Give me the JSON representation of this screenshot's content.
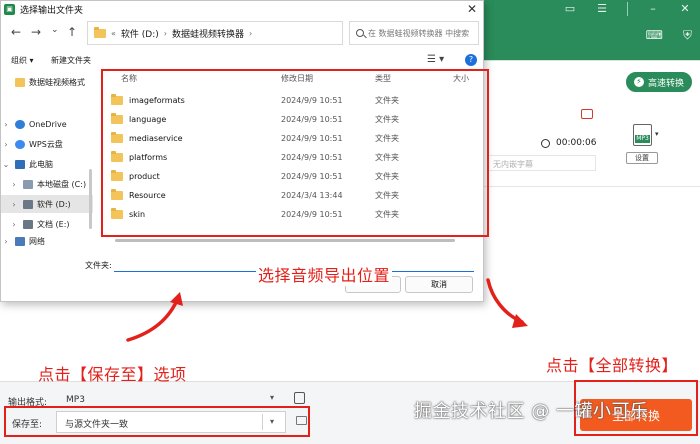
{
  "app": {
    "fast_convert_label": "高速转换",
    "duration": "00:00:06",
    "subtitle_placeholder": "无内嵌字幕",
    "format_icon_text": "MP3",
    "settings_label": "设置",
    "output_format_label": "输出格式:",
    "output_format_value": "MP3",
    "save_to_label": "保存至:",
    "save_to_value": "与源文件夹一致",
    "convert_all_label": "全部转换",
    "watermark": "掘金技术社区 @ 一罐小可乐"
  },
  "dialog": {
    "title": "选择输出文件夹",
    "breadcrumb": [
      "软件 (D:)",
      "数据蛙视频转换器"
    ],
    "search_placeholder": "在 数据蛙视频转换器 中搜索",
    "organize_label": "组织 ▾",
    "new_folder_label": "新建文件夹",
    "nav_items": [
      {
        "label": "数据蛙视频格式",
        "chevron": ""
      },
      {
        "label": "OneDrive",
        "chevron": "›"
      },
      {
        "label": "WPS云盘",
        "chevron": "›"
      },
      {
        "label": "此电脑",
        "chevron": "⌄"
      },
      {
        "label": "本地磁盘 (C:)",
        "chevron": "›"
      },
      {
        "label": "软件 (D:)",
        "chevron": "›"
      },
      {
        "label": "文档 (E:)",
        "chevron": "›"
      },
      {
        "label": "网络",
        "chevron": "›"
      }
    ],
    "columns": {
      "name": "名称",
      "date": "修改日期",
      "type": "类型",
      "size": "大小"
    },
    "files": [
      {
        "name": "imageformats",
        "date": "2024/9/9 10:51",
        "type": "文件夹"
      },
      {
        "name": "language",
        "date": "2024/9/9 10:51",
        "type": "文件夹"
      },
      {
        "name": "mediaservice",
        "date": "2024/9/9 10:51",
        "type": "文件夹"
      },
      {
        "name": "platforms",
        "date": "2024/9/9 10:51",
        "type": "文件夹"
      },
      {
        "name": "product",
        "date": "2024/9/9 10:51",
        "type": "文件夹"
      },
      {
        "name": "Resource",
        "date": "2024/3/4 13:44",
        "type": "文件夹"
      },
      {
        "name": "skin",
        "date": "2024/9/9 10:51",
        "type": "文件夹"
      }
    ],
    "folder_label": "文件夹:",
    "folder_value": "",
    "cancel_label": "取消"
  },
  "annotations": {
    "choose_location": "选择音频导出位置",
    "click_save_to": "点击【保存至】选项",
    "click_convert_all": "点击【全部转换】"
  },
  "colors": {
    "accent_green": "#2a8c5a",
    "convert_orange": "#f25a20",
    "annotation_red": "#e3211a"
  }
}
